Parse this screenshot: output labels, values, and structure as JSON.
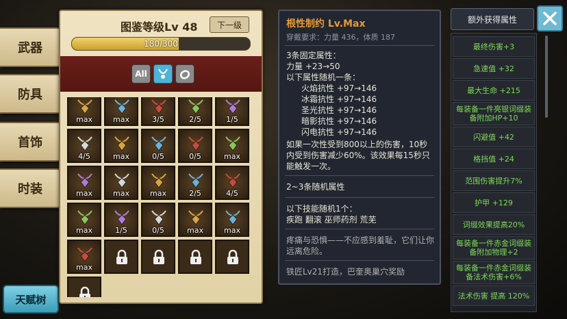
{
  "side_tabs": [
    "武器",
    "防具",
    "首饰",
    "时装"
  ],
  "talent_button": "天赋树",
  "codex": {
    "title": "图鉴等级Lv 48",
    "next_label": "下一级",
    "progress_text": "180/300",
    "progress": 0.6,
    "filters": [
      {
        "label": "All",
        "icon": "all-filter-icon"
      },
      {
        "label": "",
        "icon": "necklace-filter-icon"
      },
      {
        "label": "",
        "icon": "ring-filter-icon"
      }
    ],
    "grid": [
      [
        "max",
        "max",
        "3/5",
        "2/5",
        "1/5"
      ],
      [
        "4/5",
        "max",
        "0/5",
        "0/5",
        "max"
      ],
      [
        "max",
        "max",
        "max",
        "2/5",
        "4/5"
      ],
      [
        "max",
        "1/5",
        "0/5",
        "max",
        "max"
      ],
      [
        "max",
        "locked",
        "locked",
        "locked",
        "locked"
      ],
      [
        "locked"
      ]
    ]
  },
  "detail": {
    "title": "根性制约 Lv.Max",
    "requirement": "穿戴要求：力量 436，体质 187",
    "fixed_header": "3条固定属性：",
    "fixed_line": "力量 +23→50",
    "random_header": "以下属性随机一条：",
    "random_lines": [
      "火焰抗性 +97→146",
      "冰霜抗性 +97→146",
      "圣光抗性 +97→146",
      "暗影抗性 +97→146",
      "闪电抗性 +97→146"
    ],
    "effect_lines": [
      "如果一次性受到800以上的伤害，10秒",
      "内受到伤害减少60%。该效果每15秒只",
      "能触发一次。"
    ],
    "random_attr_label": "2~3条随机属性",
    "skill_header": "以下技能随机1个：",
    "skill_line": "疾跑  翻滚  巫师药剂  荒芜",
    "flavor_lines": [
      "疼痛与恐惧——不应感到羞耻，它们让你",
      "远离危险。"
    ],
    "source": "铁匠Lv21打造，巴奎奥巢穴奖励"
  },
  "extra_button": "额外获得属性",
  "extra_attrs": [
    [
      "最终伤害+3"
    ],
    [
      "急速值 +32"
    ],
    [
      "最大生命 +215"
    ],
    [
      "每装备一件亮银词缀装",
      "备附加HP+10"
    ],
    [
      "闪避值 +42"
    ],
    [
      "格挡值 +24"
    ],
    [
      "范围伤害提升7%"
    ],
    [
      "护甲 +129"
    ],
    [
      "词缀效果提高20%"
    ],
    [
      "每装备一件赤金词缀装",
      "备附加物理+2"
    ],
    [
      "每装备一件赤金词缀装",
      "备法术伤害+6%"
    ],
    [
      "法术伤害 提高 120%"
    ]
  ],
  "colors": {
    "accent_orange": "#e89a33",
    "attr_green": "#7ed957",
    "filter_active": "#4fb3d6"
  }
}
